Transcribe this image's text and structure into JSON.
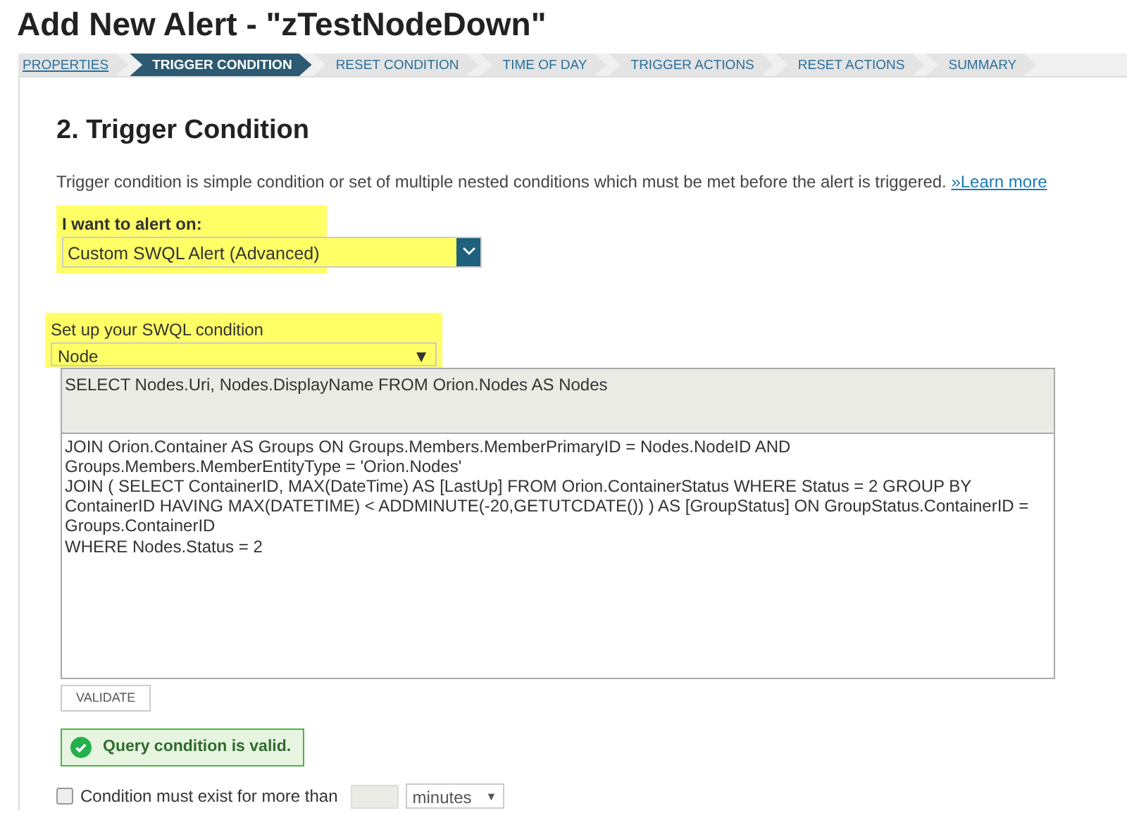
{
  "page_title": "Add New Alert - \"zTestNodeDown\"",
  "steps": [
    {
      "label": "PROPERTIES",
      "selected": false,
      "completed": true
    },
    {
      "label": "TRIGGER CONDITION",
      "selected": true,
      "completed": false
    },
    {
      "label": "RESET CONDITION",
      "selected": false,
      "completed": false
    },
    {
      "label": "TIME OF DAY",
      "selected": false,
      "completed": false
    },
    {
      "label": "TRIGGER ACTIONS",
      "selected": false,
      "completed": false
    },
    {
      "label": "RESET ACTIONS",
      "selected": false,
      "completed": false
    },
    {
      "label": "SUMMARY",
      "selected": false,
      "completed": false
    }
  ],
  "section_title": "2. Trigger Condition",
  "description": "Trigger condition is simple condition or set of multiple nested conditions which must be met before the alert is triggered.",
  "learn_more": "»Learn more",
  "alert_on": {
    "label": "I want to alert on:",
    "value": "Custom SWQL Alert (Advanced)"
  },
  "swql": {
    "label": "Set up your SWQL condition",
    "value": "Node",
    "arrow": "▼"
  },
  "query_select": "SELECT Nodes.Uri, Nodes.DisplayName FROM Orion.Nodes AS Nodes",
  "query_lines": [
    "JOIN Orion.Container AS Groups ON Groups.Members.MemberPrimaryID = Nodes.NodeID AND",
    "Groups.Members.MemberEntityType = 'Orion.Nodes'",
    "JOIN ( SELECT ContainerID, MAX(DateTime) AS [LastUp] FROM Orion.ContainerStatus WHERE Status = 2 GROUP BY",
    "ContainerID HAVING MAX(DATETIME) < ADDMINUTE(-20,GETUTCDATE()) ) AS [GroupStatus] ON GroupStatus.ContainerID =",
    "Groups.ContainerID",
    "WHERE Nodes.Status = 2"
  ],
  "validate_button": "VALIDATE",
  "valid_message": "Query condition is valid.",
  "condition_exist": {
    "label": "Condition must exist for more than",
    "checked": false,
    "unit": "minutes",
    "arrow": "▼"
  }
}
